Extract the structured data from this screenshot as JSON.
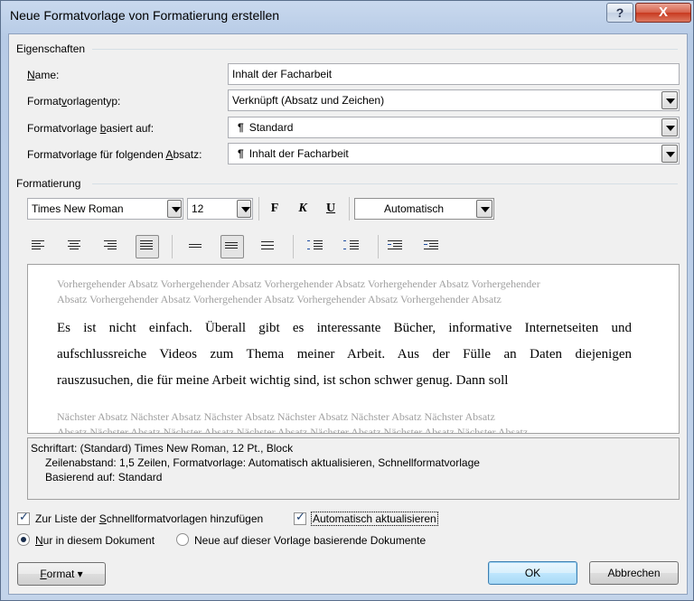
{
  "window": {
    "title": "Neue Formatvorlage von Formatierung erstellen",
    "help_label": "?",
    "close_label": "X"
  },
  "eigenschaften": {
    "section_title": "Eigenschaften",
    "name_label_pre": "N",
    "name_label_post": "ame:",
    "name_value": "Inhalt der Facharbeit",
    "typ_label_pre": "Format",
    "typ_label_u": "v",
    "typ_label_post": "orlagentyp:",
    "typ_value": "Verknüpft (Absatz und Zeichen)",
    "basiert_label_pre": "Formatvorlage ",
    "basiert_label_u": "b",
    "basiert_label_post": "asiert auf:",
    "basiert_value": "Standard",
    "folgend_label_pre": "Formatvorlage für folgenden ",
    "folgend_label_u": "A",
    "folgend_label_post": "bsatz:",
    "folgend_value": "Inhalt der Facharbeit",
    "paragraph_icon": "¶"
  },
  "formatierung": {
    "section_title": "Formatierung",
    "font_value": "Times New Roman",
    "size_value": "12",
    "bold_label": "F",
    "italic_label": "K",
    "underline_label": "U",
    "color_value": "Automatisch"
  },
  "preview": {
    "previous_text_1": "Vorhergehender Absatz Vorhergehender Absatz Vorhergehender Absatz Vorhergehender Absatz Vorhergehender",
    "previous_text_2": "Absatz Vorhergehender Absatz Vorhergehender Absatz Vorhergehender Absatz Vorhergehender Absatz",
    "sample_line_1": "Es ist nicht einfach. Überall gibt es interessante Bücher, informative Internetseiten und",
    "sample_line_2": "aufschlussreiche Videos zum Thema meiner Arbeit. Aus der Fülle an Daten diejenigen",
    "sample_line_3": "rauszusuchen, die für meine Arbeit wichtig sind, ist schon schwer genug. Dann soll",
    "next_text_1": "Nächster Absatz Nächster Absatz Nächster Absatz Nächster Absatz Nächster Absatz Nächster Absatz",
    "next_text_2": "Absatz Nächster Absatz Nächster Absatz Nächster Absatz Nächster Absatz Nächster Absatz Nächster Absatz"
  },
  "description": {
    "line_1": "Schriftart: (Standard) Times New Roman, 12 Pt., Block",
    "line_2": "Zeilenabstand:  1,5 Zeilen, Formatvorlage: Automatisch aktualisieren, Schnellformatvorlage",
    "line_3": "Basierend auf: Standard"
  },
  "options": {
    "add_to_quick_list_pre": "Zur Liste der ",
    "add_to_quick_list_u": "S",
    "add_to_quick_list_post": "chnellformatvorlagen hinzufügen",
    "add_to_quick_list_checked": true,
    "auto_update": "Automatisch aktualisieren",
    "auto_update_checked": true,
    "only_this_doc_u": "N",
    "only_this_doc_post": "ur in diesem Dokument",
    "only_this_doc_selected": true,
    "new_docs": "Neue auf dieser Vorlage basierende Dokumente",
    "new_docs_selected": false
  },
  "buttons": {
    "format_pre": "F",
    "format_post": "ormat ▾",
    "ok": "OK",
    "cancel": "Abbrechen"
  },
  "icons": {
    "help": "question-mark",
    "close": "x-mark",
    "align_left": "align-left-icon",
    "align_center": "align-center-icon",
    "align_right": "align-right-icon",
    "align_justify": "align-justify-icon"
  },
  "colors": {
    "title_bar": "#b7cbe6",
    "close_button": "#c8391f",
    "dialog_bg": "#f0f0f0",
    "preview_grey_text": "#a0a0a0"
  }
}
